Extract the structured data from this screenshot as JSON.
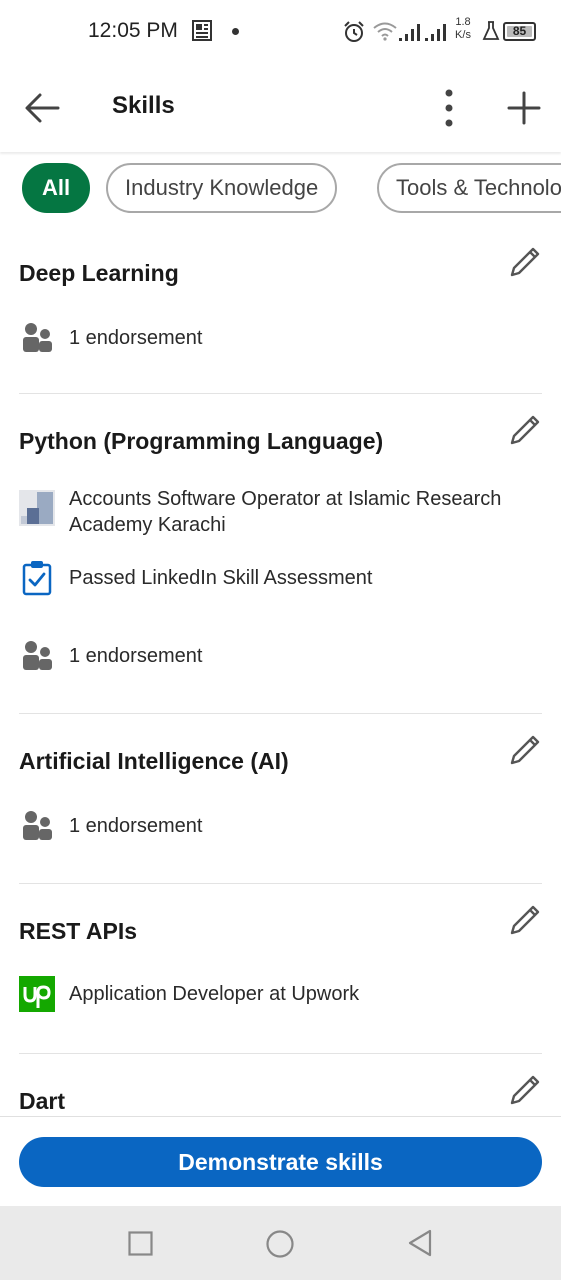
{
  "status_bar": {
    "time": "12:05 PM",
    "speed_value": "1.8",
    "speed_unit": "K/s",
    "battery": "85"
  },
  "top_bar": {
    "title": "Skills",
    "icons": {
      "back": "arrow-left-icon",
      "more": "more-vertical-icon",
      "add": "plus-icon"
    }
  },
  "filters": [
    {
      "label": "All",
      "selected": true
    },
    {
      "label": "Industry Knowledge",
      "selected": false
    },
    {
      "label": "Tools & Technologies",
      "selected": false
    }
  ],
  "skills": [
    {
      "name": "Deep Learning",
      "details": [
        {
          "icon": "people-icon",
          "text": "1 endorsement"
        }
      ]
    },
    {
      "name": "Python (Programming Language)",
      "details": [
        {
          "icon": "company-logo-icon",
          "text": "Accounts Software Operator at Islamic Research Academy Karachi"
        },
        {
          "icon": "assessment-clipboard-icon",
          "text": "Passed LinkedIn Skill Assessment"
        },
        {
          "icon": "people-icon",
          "text": "1 endorsement"
        }
      ]
    },
    {
      "name": "Artificial Intelligence (AI)",
      "details": [
        {
          "icon": "people-icon",
          "text": "1 endorsement"
        }
      ]
    },
    {
      "name": "REST APIs",
      "details": [
        {
          "icon": "upwork-logo-icon",
          "text": "Application Developer at Upwork"
        }
      ]
    },
    {
      "name": "Dart",
      "details": []
    }
  ],
  "actions": {
    "demonstrate_label": "Demonstrate skills"
  },
  "colors": {
    "accent_blue": "#0a66c2",
    "chip_selected_green": "#057642",
    "upwork_green": "#14a800"
  }
}
